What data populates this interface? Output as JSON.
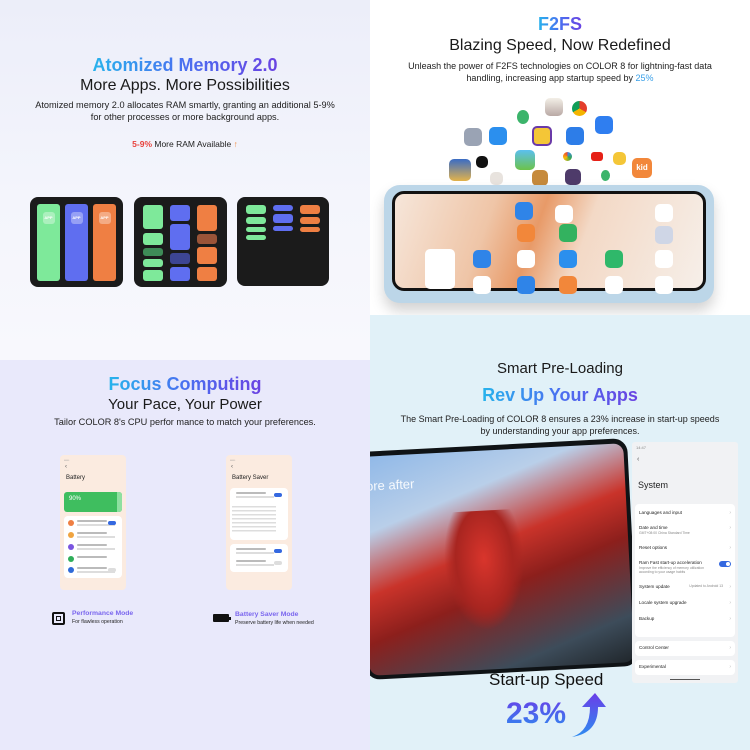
{
  "panels": {
    "memory": {
      "title": "Atomized Memory 2.0",
      "subtitle": "More Apps. More Possibilities",
      "body_line1": "Atomized memory 2.0 allocates RAM smartly, granting an additional 5-9%",
      "body_line2": "for other processes or more background apps.",
      "highlight_pct": "5-9%",
      "highlight_text": " More RAM Available",
      "arrow": "↑",
      "app_badge": "APP",
      "colors": {
        "green": "#7ee99a",
        "blue": "#5f6ef0",
        "orange": "#ef7f43",
        "highlight": "#e8423c",
        "arrow": "#f0883a"
      }
    },
    "f2fs": {
      "title": "F2FS",
      "subtitle": "Blazing Speed, Now Redefined",
      "body_line1": "Unleash the power of F2FS technologies on COLOR 8 for lightning-fast data",
      "body_line2_prefix": "handling, increasing app startup speed by ",
      "body_line2_pct": "25%",
      "kid_icon_label": "kid",
      "pct_color": "#3aa0e8"
    },
    "focus": {
      "title": "Focus Computing",
      "subtitle": "Your Pace, Your Power",
      "body": "Tailor COLOR 8's CPU perfor mance to match your preferences.",
      "battery_screen": {
        "title": "Battery",
        "level": "90%",
        "back": "‹"
      },
      "saver_screen": {
        "title": "Battery Saver",
        "back": "‹"
      },
      "modes": [
        {
          "label": "Performance Mode",
          "sub": "For flawless operation",
          "icon": "chip-icon"
        },
        {
          "label": "Battery Saver Mode",
          "sub": "Preserve battery life when needed",
          "icon": "battery-icon"
        }
      ]
    },
    "preload": {
      "title": "Smart Pre-Loading",
      "subtitle": "Rev Up Your Apps",
      "body_line1": "The Smart Pre-Loading of COLOR 8 ensures a 23% increase in start-up speeds",
      "body_line2": "by understanding your app preferences.",
      "overlay_text": "ore after",
      "speed_label": "Start-up Speed",
      "speed_pct": "23%",
      "settings": {
        "status": "14:47",
        "back": "‹",
        "title": "System",
        "items": [
          {
            "label": "Languages and input"
          },
          {
            "label": "Date and time",
            "sub": "GMT+08:00 China Standard Time"
          },
          {
            "label": "Reset options"
          },
          {
            "label": "Ram Fast start-up acceleration",
            "sub": "Improve the efficiency of memory utilization according to your usage habits",
            "toggle": true
          },
          {
            "label": "System update",
            "value": "Updated to Android 13"
          },
          {
            "label": "Locale system upgrade"
          },
          {
            "label": "Backup"
          },
          {
            "label": "Control Center"
          },
          {
            "label": "Experimental"
          }
        ],
        "chevron": "›"
      }
    }
  }
}
